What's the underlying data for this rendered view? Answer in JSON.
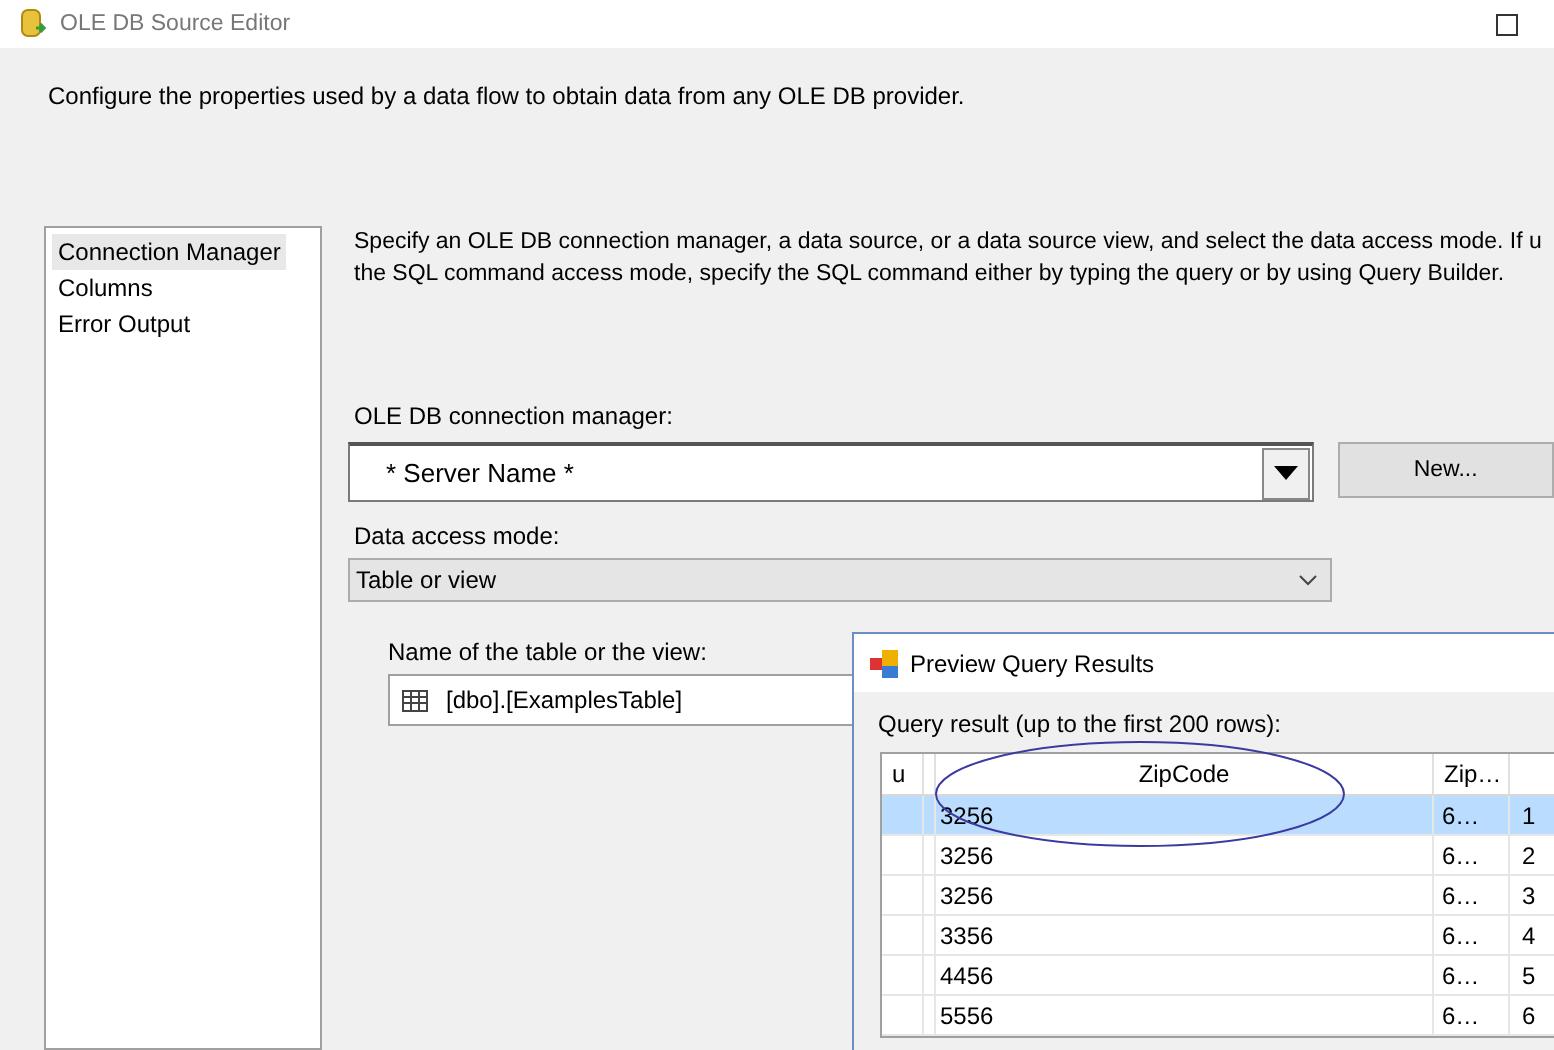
{
  "window": {
    "title": "OLE DB Source Editor"
  },
  "description": "Configure the properties used by a data flow to obtain data from any OLE DB provider.",
  "sidebar": {
    "items": [
      {
        "label": "Connection Manager",
        "selected": true
      },
      {
        "label": "Columns",
        "selected": false
      },
      {
        "label": "Error Output",
        "selected": false
      }
    ]
  },
  "instructions": [
    "Specify an OLE DB connection manager, a data source, or a data source view, and select the data access mode. If u",
    "the SQL command access mode, specify the SQL command either by typing the query or by using Query Builder."
  ],
  "connection_manager": {
    "label": "OLE DB connection manager:",
    "value": "* Server Name *",
    "new_button": "New..."
  },
  "data_access_mode": {
    "label": "Data access mode:",
    "value": "Table or view"
  },
  "table_name": {
    "label": "Name of the table or the view:",
    "value": "[dbo].[ExamplesTable]"
  },
  "preview": {
    "title": "Preview Query Results",
    "caption": "Query result (up to the first 200 rows):",
    "columns": [
      "u",
      "",
      "ZipCode",
      "Zip…",
      ""
    ],
    "rows": [
      {
        "cells": [
          "",
          "",
          "3256",
          "6…",
          "1"
        ],
        "selected": true
      },
      {
        "cells": [
          "",
          "",
          "3256",
          "6…",
          "2"
        ],
        "selected": false
      },
      {
        "cells": [
          "",
          "",
          "3256",
          "6…",
          "3"
        ],
        "selected": false
      },
      {
        "cells": [
          "",
          "",
          "3356",
          "6…",
          "4"
        ],
        "selected": false
      },
      {
        "cells": [
          "",
          "",
          "4456",
          "6…",
          "5"
        ],
        "selected": false
      },
      {
        "cells": [
          "",
          "",
          "5556",
          "6…",
          "6"
        ],
        "selected": false
      }
    ]
  }
}
